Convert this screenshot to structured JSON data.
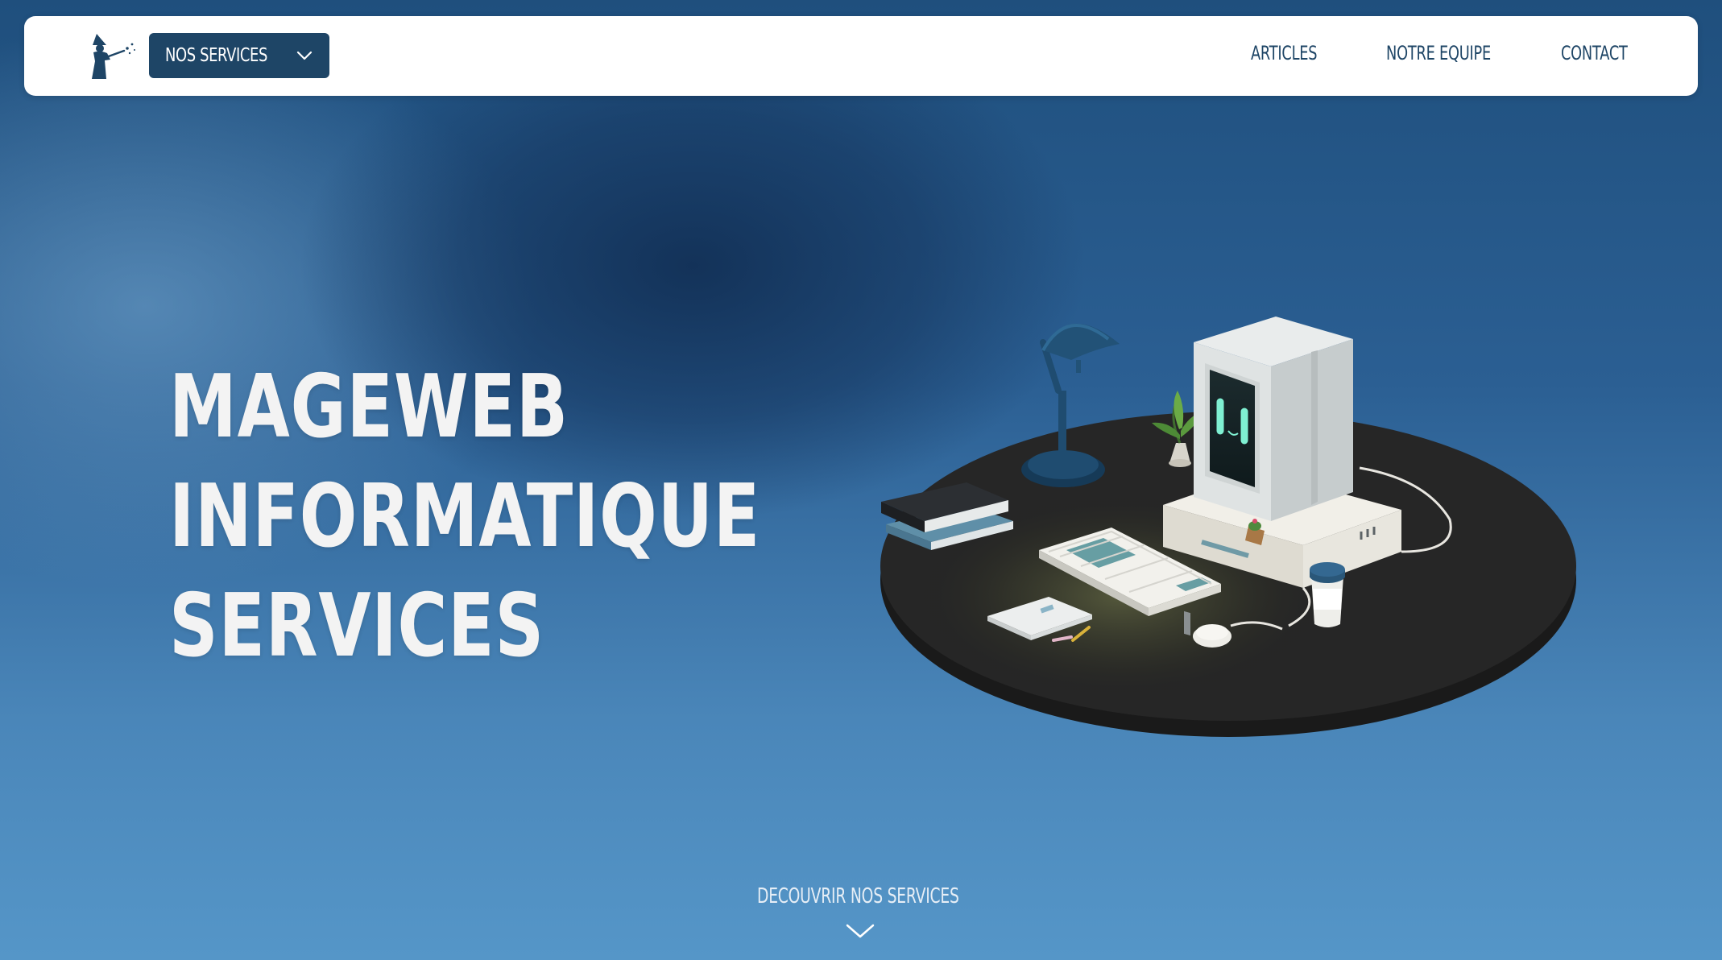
{
  "header": {
    "logo_icon": "wizard-logo-icon",
    "services_button_label": "NOS SERVICES",
    "services_button_icon": "chevron-down-icon",
    "nav_links": [
      "ARTICLES",
      "NOTRE EQUIPE",
      "CONTACT"
    ]
  },
  "hero": {
    "title_lines": [
      "MAGEWEB",
      "INFORMATIQUE",
      "SERVICES"
    ]
  },
  "discover": {
    "label": "DECOUVRIR NOS SERVICES",
    "icon": "chevron-down-icon"
  },
  "colors": {
    "brand_dark": "#1e4566",
    "hero_text": "#f3f3f3",
    "background_top": "#1f4f7d",
    "background_bottom": "#5596c8"
  }
}
